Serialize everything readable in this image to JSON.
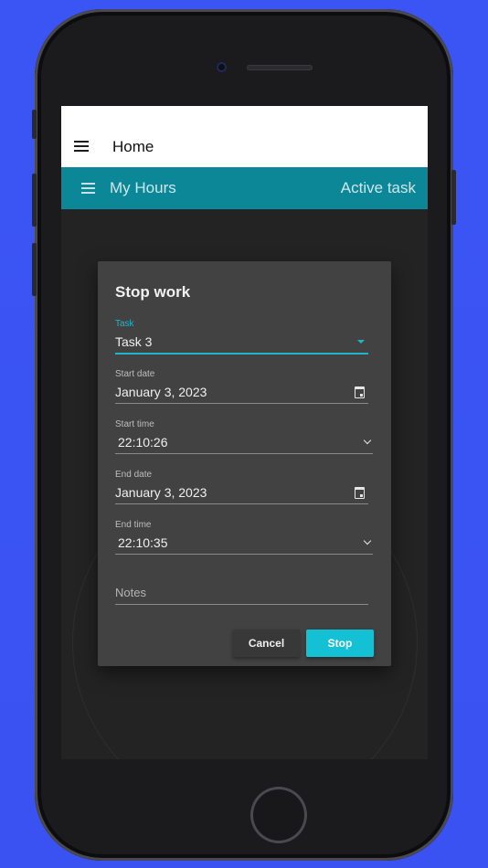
{
  "top_appbar": {
    "title": "Home"
  },
  "sub_appbar": {
    "title": "My Hours",
    "action": "Active task"
  },
  "dialog": {
    "title": "Stop work",
    "task": {
      "label": "Task",
      "value": "Task 3"
    },
    "start_date": {
      "label": "Start date",
      "value": "January 3, 2023"
    },
    "start_time": {
      "label": "Start time",
      "value": "22:10:26"
    },
    "end_date": {
      "label": "End date",
      "value": "January 3, 2023"
    },
    "end_time": {
      "label": "End time",
      "value": "22:10:35"
    },
    "notes": {
      "placeholder": "Notes",
      "value": ""
    },
    "cancel_label": "Cancel",
    "stop_label": "Stop"
  },
  "colors": {
    "background": "#3a54f5",
    "accent": "#1fb6cc",
    "appbar_teal": "#0b8798",
    "stop_button": "#14c0d4"
  }
}
